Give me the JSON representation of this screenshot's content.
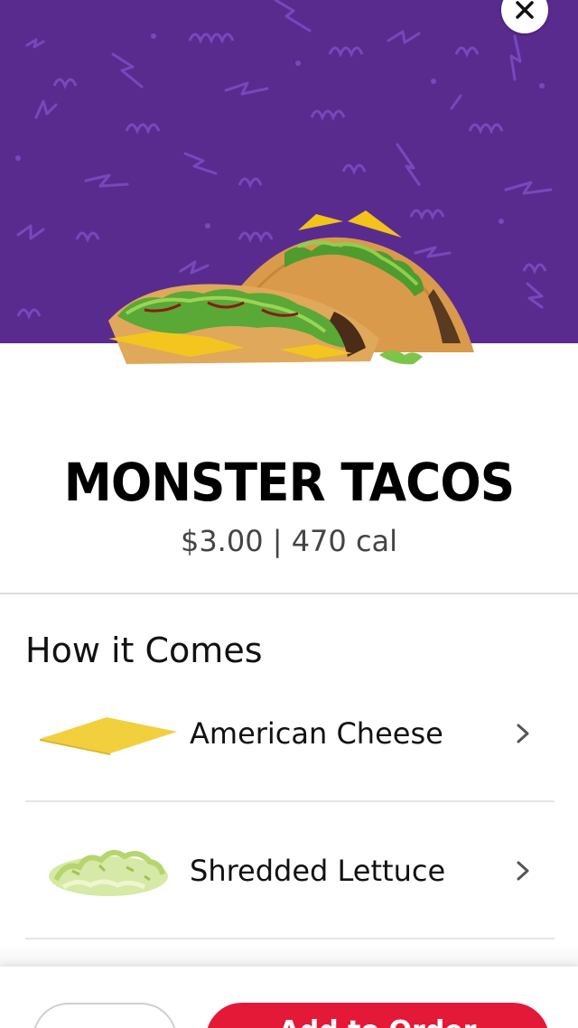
{
  "product": {
    "name": "MONSTER TACOS",
    "price_line": "$3.00 | 470 cal"
  },
  "how_it_comes": {
    "title": "How it Comes",
    "items": [
      {
        "label": "American Cheese",
        "icon": "cheese-slice"
      },
      {
        "label": "Shredded Lettuce",
        "icon": "lettuce"
      }
    ]
  },
  "footer": {
    "add_label": "Add to Order"
  },
  "colors": {
    "hero_bg": "#5a2b8f",
    "accent": "#e31937"
  }
}
